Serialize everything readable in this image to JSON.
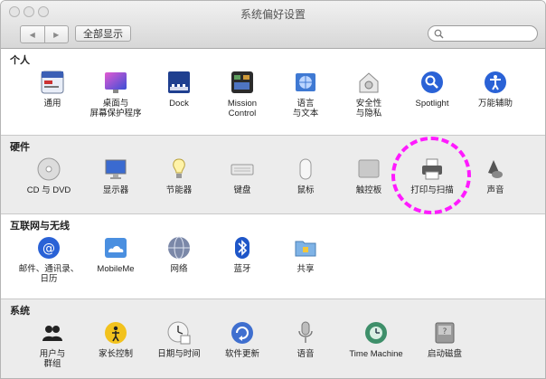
{
  "window": {
    "title": "系统偏好设置"
  },
  "toolbar": {
    "back_glyph": "◀",
    "forward_glyph": "▶",
    "show_all_label": "全部显示",
    "search_placeholder": ""
  },
  "sections": {
    "personal": {
      "title": "个人",
      "items": [
        {
          "label": "通用",
          "icon": "general-icon"
        },
        {
          "label": "桌面与\n屏幕保护程序",
          "icon": "desktop-screensaver-icon"
        },
        {
          "label": "Dock",
          "icon": "dock-icon"
        },
        {
          "label": "Mission\nControl",
          "icon": "mission-control-icon"
        },
        {
          "label": "语言\n与文本",
          "icon": "language-text-icon"
        },
        {
          "label": "安全性\n与隐私",
          "icon": "security-privacy-icon"
        },
        {
          "label": "Spotlight",
          "icon": "spotlight-icon"
        },
        {
          "label": "万能辅助",
          "icon": "accessibility-icon"
        }
      ]
    },
    "hardware": {
      "title": "硬件",
      "items": [
        {
          "label": "CD 与 DVD",
          "icon": "cd-dvd-icon"
        },
        {
          "label": "显示器",
          "icon": "displays-icon"
        },
        {
          "label": "节能器",
          "icon": "energy-saver-icon"
        },
        {
          "label": "键盘",
          "icon": "keyboard-icon"
        },
        {
          "label": "鼠标",
          "icon": "mouse-icon"
        },
        {
          "label": "触控板",
          "icon": "trackpad-icon"
        },
        {
          "label": "打印与扫描",
          "icon": "print-scan-icon"
        },
        {
          "label": "声音",
          "icon": "sound-icon"
        }
      ]
    },
    "internet": {
      "title": "互联网与无线",
      "items": [
        {
          "label": "邮件、通讯录、\n日历",
          "icon": "mail-contacts-calendar-icon"
        },
        {
          "label": "MobileMe",
          "icon": "mobileme-icon"
        },
        {
          "label": "网络",
          "icon": "network-icon"
        },
        {
          "label": "蓝牙",
          "icon": "bluetooth-icon"
        },
        {
          "label": "共享",
          "icon": "sharing-icon"
        }
      ]
    },
    "system": {
      "title": "系统",
      "items": [
        {
          "label": "用户与\n群组",
          "icon": "users-groups-icon"
        },
        {
          "label": "家长控制",
          "icon": "parental-controls-icon"
        },
        {
          "label": "日期与时间",
          "icon": "date-time-icon"
        },
        {
          "label": "软件更新",
          "icon": "software-update-icon"
        },
        {
          "label": "语音",
          "icon": "speech-icon"
        },
        {
          "label": "Time Machine",
          "icon": "time-machine-icon"
        },
        {
          "label": "启动磁盘",
          "icon": "startup-disk-icon"
        }
      ]
    }
  },
  "colors": {
    "highlight": "#ff1aff",
    "accent_blue": "#2a62d6"
  }
}
